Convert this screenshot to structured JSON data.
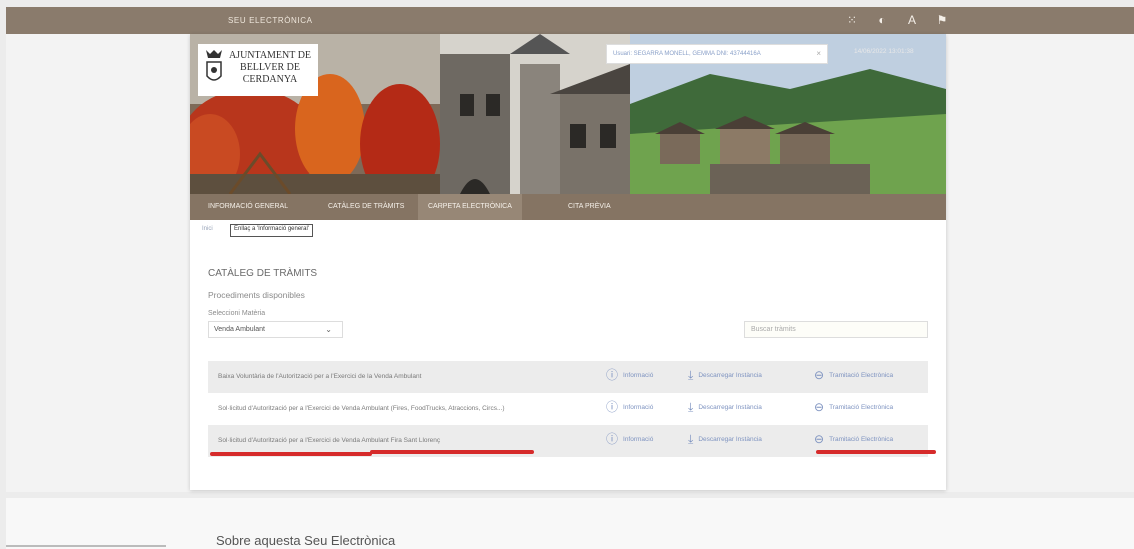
{
  "topbar": {
    "brand": "SEU ELECTRÒNICA",
    "icons": [
      "menu-dots-icon",
      "contrast-icon",
      "font-size-icon",
      "flag-icon"
    ]
  },
  "header": {
    "logo_lines": [
      "AJUNTAMENT DE",
      "BELLVER DE",
      "CERDANYA"
    ],
    "user": "Usuari: SEGARRA MONELL, GEMMA DNI: 43744416A",
    "user_close": "×",
    "datetime": "14/06/2022 13:01:38"
  },
  "nav": {
    "items": [
      "INFORMACIÓ GENERAL",
      "CATÀLEG DE TRÀMITS",
      "CARPETA ELECTRÒNICA",
      "CITA PRÈVIA"
    ],
    "active_index": 2
  },
  "breadcrumb": {
    "home": "Inici",
    "link": "Enllaç a 'Informació general'"
  },
  "catalog": {
    "title": "CATÀLEG DE TRÀMITS",
    "subtitle": "Procediments disponibles",
    "select_label": "Seleccioni Matèria",
    "select_value": "Venda Ambulant",
    "search_placeholder": "Buscar tràmits",
    "rows": [
      {
        "name": "Baixa Voluntària de l'Autorització per a l'Exercici de la Venda Ambulant",
        "info": "Informació",
        "download": "Descarregar Instància",
        "electronic": "Tramitació Electrònica"
      },
      {
        "name": "Sol·licitud d'Autorització per a l'Exercici de Venda Ambulant (Fires, FoodTrucks, Atraccions, Circs...)",
        "info": "Informació",
        "download": "Descarregar Instància",
        "electronic": "Tramitació Electrònica"
      },
      {
        "name": "Sol·licitud d'Autorització per a l'Exercici de Venda Ambulant Fira Sant Llorenç",
        "info": "Informació",
        "download": "Descarregar Instància",
        "electronic": "Tramitació Electrònica"
      }
    ]
  },
  "footer": {
    "about": "Sobre aquesta Seu Electrònica"
  },
  "colors": {
    "topbar": "#8a7b6c",
    "nav": "#857463",
    "link": "#7e93c0",
    "highlight": "#d62b2b"
  }
}
